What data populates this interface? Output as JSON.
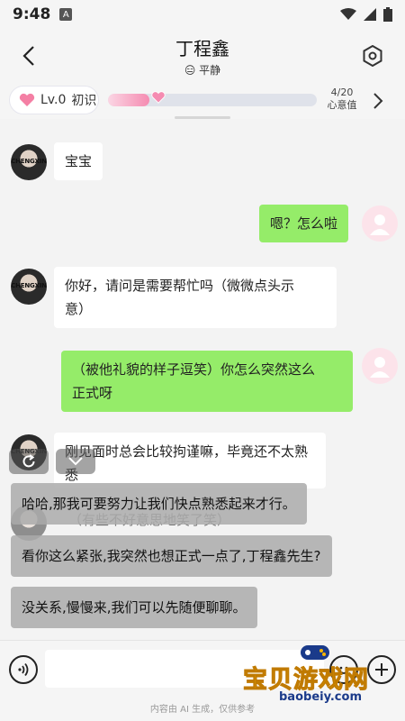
{
  "status_bar": {
    "time": "9:48",
    "notification_icon": "A"
  },
  "header": {
    "title": "丁程鑫",
    "mood_emoji": "😑",
    "mood_label": "平静"
  },
  "level": {
    "label": "Lv.0",
    "stage": "初识",
    "count": "4/20",
    "count_label": "心意值",
    "progress": 0.2,
    "accent": "#f58bb1"
  },
  "messages": [
    {
      "sender": "them",
      "text": "宝宝"
    },
    {
      "sender": "me",
      "text": "嗯？怎么啦"
    },
    {
      "sender": "them",
      "line1": "你好，请问是需要帮忙吗（微微点头示",
      "line2": "意）"
    },
    {
      "sender": "me",
      "line1": "（被他礼貌的样子逗笑）你怎么突然这么",
      "line2": "正式呀"
    },
    {
      "sender": "them",
      "line1": "刚见面时总会比较拘谨嘛，毕竟还不太熟",
      "line2": "悉"
    },
    {
      "sender": "them",
      "text": "（有些不好意思地笑了笑）"
    }
  ],
  "avatar_text": "CHENGXIN",
  "suggestions": [
    "哈哈,那我可要努力让我们快点熟悉起来才行。",
    "看你这么紧张,我突然也想正式一点了,丁程鑫先生?",
    "没关系,慢慢来,我们可以先随便聊聊。"
  ],
  "input": {
    "placeholder": ""
  },
  "disclaimer": "内容由 AI 生成，仅供参考",
  "watermark": {
    "main": "宝贝游戏网",
    "sub": "baobeiy.com"
  },
  "colors": {
    "my_bubble": "#95ec69",
    "their_bubble": "#ffffff",
    "accent_pink": "#f58bb1"
  }
}
